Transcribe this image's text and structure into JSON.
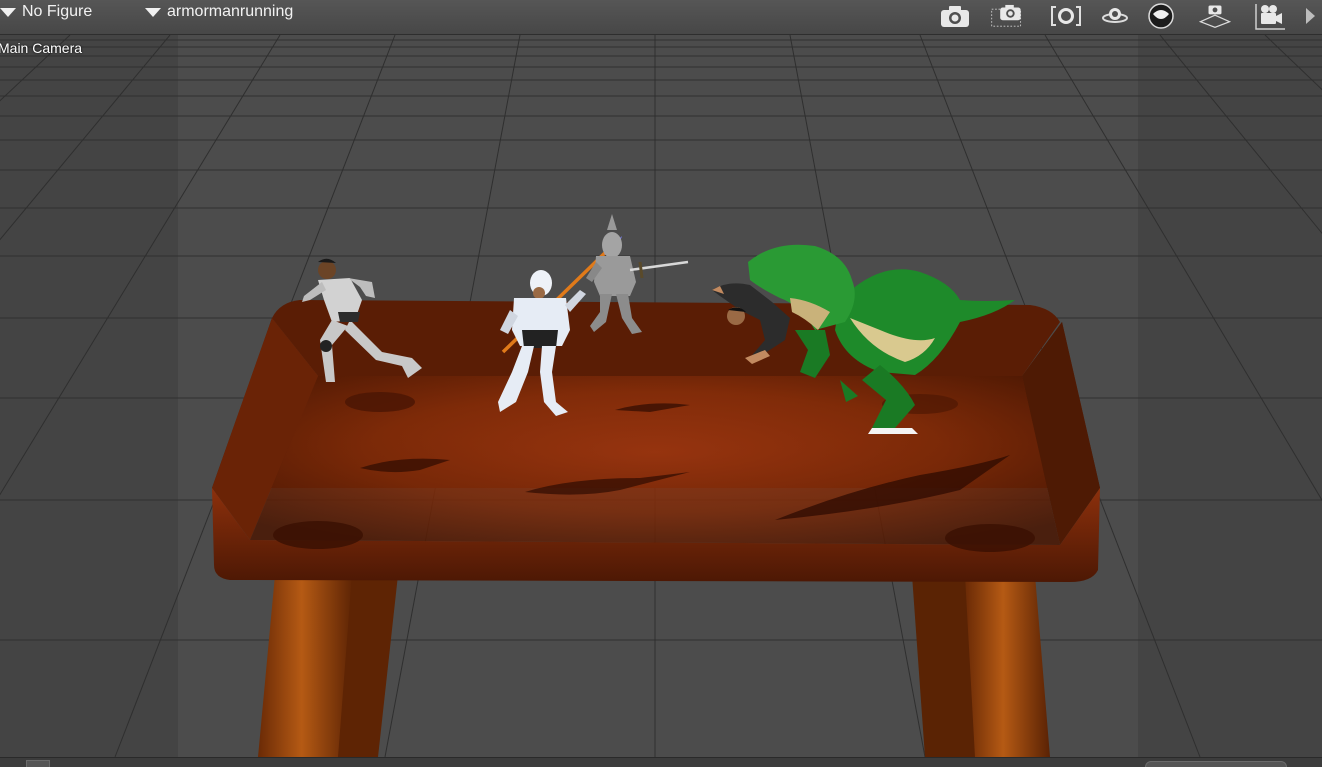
{
  "toolbar": {
    "figure_dropdown": {
      "value": "No Figure",
      "icon": "triangle-down-icon"
    },
    "animation_dropdown": {
      "value": "armormanrunning",
      "icon": "triangle-down-icon"
    },
    "tools": [
      {
        "name": "camera-snapshot-icon"
      },
      {
        "name": "camera-region-snapshot-icon"
      },
      {
        "name": "camera-frame-icon"
      },
      {
        "name": "camera-orbit-icon"
      },
      {
        "name": "sphere-render-icon"
      },
      {
        "name": "camera-floor-icon"
      },
      {
        "name": "video-camera-icon"
      },
      {
        "name": "chevron-right-icon"
      }
    ]
  },
  "viewport": {
    "camera_label": "Main Camera",
    "background_color": "#4b4b4b",
    "grid_color": "#2f2f2f"
  },
  "scene": {
    "objects": [
      {
        "name": "wooden-table",
        "color": "#8a2d08"
      },
      {
        "name": "running-knight",
        "color": "#cfcfcf"
      },
      {
        "name": "spear-knight",
        "color": "#e6ecf5"
      },
      {
        "name": "sword-knight",
        "color": "#9a9a9a"
      },
      {
        "name": "green-trex",
        "color": "#1e8a2a"
      },
      {
        "name": "captured-man",
        "color": "#2c2c2c"
      }
    ]
  }
}
